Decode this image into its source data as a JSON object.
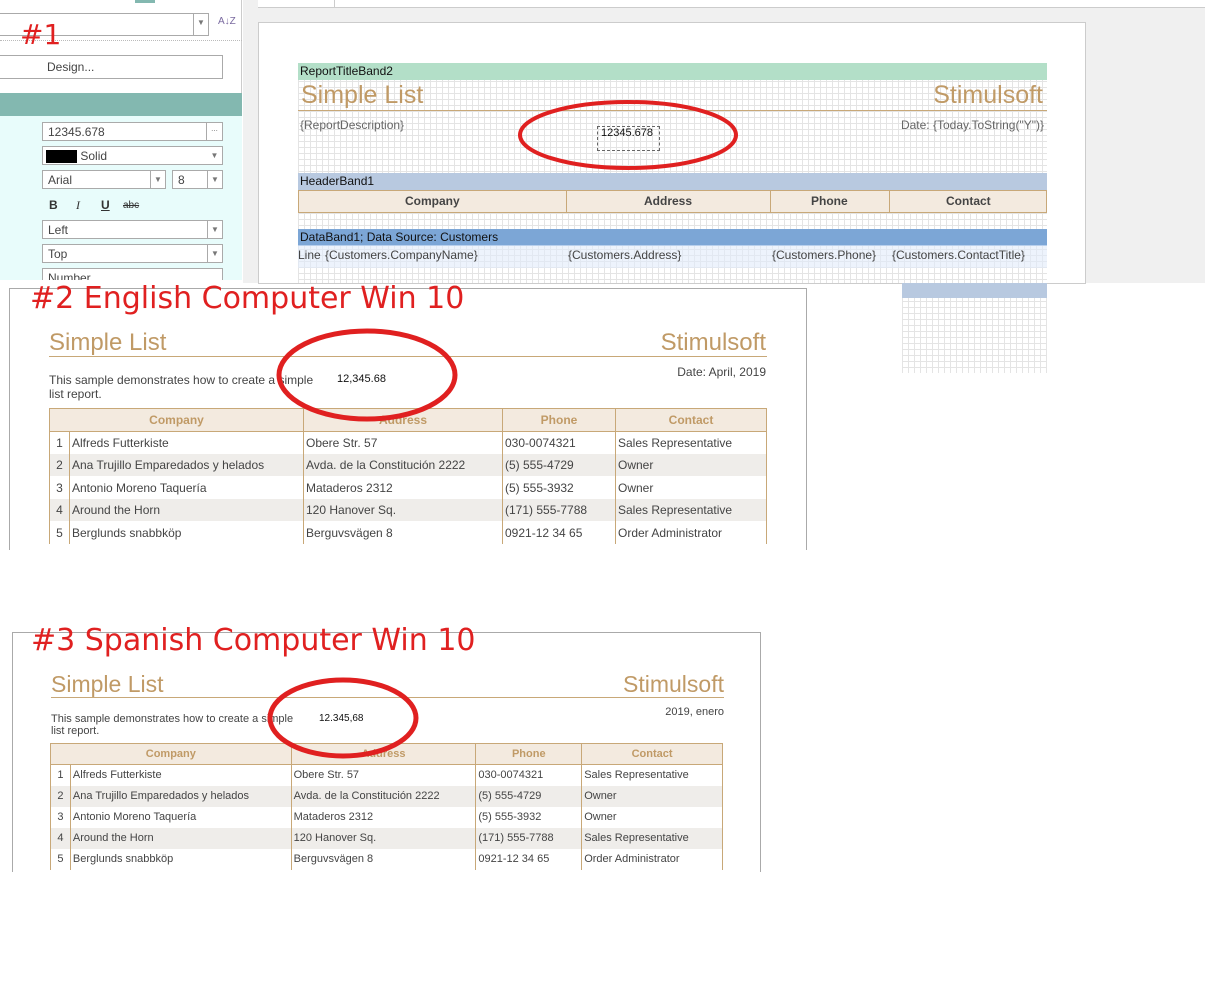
{
  "labels": {
    "p1": "#1",
    "p2": "#2  English Computer Win 10",
    "p3": "#3 Spanish Computer Win 10"
  },
  "props": {
    "design_button": "Design...",
    "text_value": "12345.678",
    "ellipsis": "...",
    "border_style": "Solid",
    "font_name": "Arial",
    "font_size": "8",
    "bold": "B",
    "italic": "I",
    "underline": "U",
    "strike": "abc",
    "h_align": "Left",
    "v_align": "Top",
    "format": "Number",
    "sort_icon": "A↓Z"
  },
  "designer": {
    "title_band": "ReportTitleBand2",
    "title": "Simple List",
    "brand": "Stimulsoft",
    "description": "{ReportDescription}",
    "selected_text": "12345.678",
    "date": "Date: {Today.ToString(\"Y\")}",
    "header_band": "HeaderBand1",
    "columns": [
      "Company",
      "Address",
      "Phone",
      "Contact"
    ],
    "data_band": "DataBand1; Data Source: Customers",
    "line": "Line",
    "fields": [
      "{Customers.CompanyName}",
      "{Customers.Address}",
      "{Customers.Phone}",
      "{Customers.ContactTitle}"
    ]
  },
  "preview_en": {
    "title": "Simple List",
    "brand": "Stimulsoft",
    "description_1": "This sample demonstrates how to create a simple",
    "description_2": "list report.",
    "number": "12,345.68",
    "date": "Date: April, 2019"
  },
  "preview_es": {
    "title": "Simple List",
    "brand": "Stimulsoft",
    "description_1": "This sample demonstrates how to create a simple",
    "description_2": "list report.",
    "number": "12.345,68",
    "date": "2019, enero"
  },
  "table": {
    "columns": [
      "Company",
      "Address",
      "Phone",
      "Contact"
    ],
    "rows": [
      [
        "1",
        "Alfreds Futterkiste",
        "Obere Str. 57",
        "030-0074321",
        "Sales Representative"
      ],
      [
        "2",
        "Ana Trujillo Emparedados y helados",
        "Avda. de la Constitución 2222",
        "(5) 555-4729",
        "Owner"
      ],
      [
        "3",
        "Antonio Moreno Taquería",
        "Mataderos 2312",
        "(5) 555-3932",
        "Owner"
      ],
      [
        "4",
        "Around the Horn",
        "120 Hanover Sq.",
        "(171) 555-7788",
        "Sales Representative"
      ],
      [
        "5",
        "Berglunds snabbköp",
        "Berguvsvägen 8",
        "0921-12 34 65",
        "Order Administrator"
      ]
    ]
  },
  "colors": {
    "accent": "#c09a66",
    "annotation": "#e02020",
    "title_band": "#b3dfc8",
    "header_band": "#b8c9e0",
    "data_band": "#7ca6d6",
    "panel_header": "#83b8b0"
  }
}
